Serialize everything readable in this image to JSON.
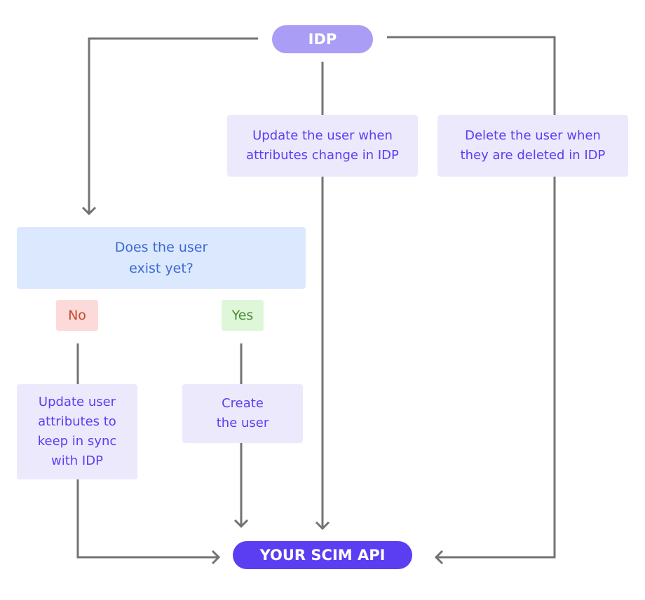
{
  "diagram": {
    "source": "IDP",
    "target": "YOUR SCIM API",
    "update_on_change": "Update the user when\nattributes change in IDP",
    "delete_on_delete": "Delete the user when\nthey are deleted in IDP",
    "question": "Does the user\nexist yet?",
    "branch_no": "No",
    "branch_yes": "Yes",
    "no_action": "Update user\nattributes to\nkeep in sync\nwith IDP",
    "yes_action": "Create\nthe user"
  },
  "colors": {
    "source_fill": "#a99df6",
    "target_fill": "#5b3df2",
    "action_fill": "#ece9fd",
    "action_text": "#5b3df2",
    "question_fill": "#dce8fd",
    "question_text": "#3b6ad6",
    "no_fill": "#fddada",
    "no_text": "#c34b2a",
    "yes_fill": "#def7d8",
    "yes_text": "#4d8a37",
    "connector": "#737373"
  }
}
